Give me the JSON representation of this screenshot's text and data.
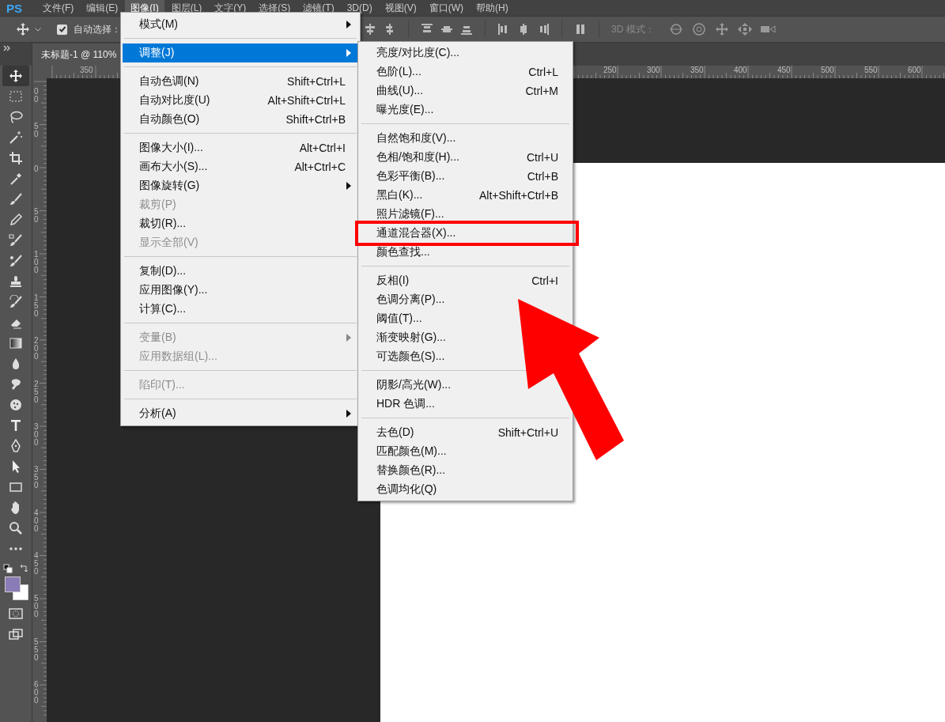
{
  "app_logo": "PS",
  "menubar": {
    "items": [
      {
        "label": "文件(F)",
        "selected": false
      },
      {
        "label": "编辑(E)",
        "selected": false
      },
      {
        "label": "图像(I)",
        "selected": true
      },
      {
        "label": "图层(L)",
        "selected": false
      },
      {
        "label": "文字(Y)",
        "selected": false
      },
      {
        "label": "选择(S)",
        "selected": false
      },
      {
        "label": "滤镜(T)",
        "selected": false
      },
      {
        "label": "3D(D)",
        "selected": false
      },
      {
        "label": "视图(V)",
        "selected": false
      },
      {
        "label": "窗口(W)",
        "selected": false
      },
      {
        "label": "帮助(H)",
        "selected": false
      }
    ]
  },
  "options_bar": {
    "auto_select": {
      "label": "自动选择：",
      "checked": true
    },
    "mode_label": "3D 模式："
  },
  "document_tab": {
    "title": "未标题-1 @ 110%"
  },
  "top_ruler": [
    "350",
    "250",
    "300",
    "350",
    "400",
    "450",
    "500",
    "550",
    "600"
  ],
  "left_ruler": [
    "00",
    "50",
    "0",
    "50",
    "100",
    "150",
    "200",
    "250",
    "300",
    "350",
    "400",
    "450",
    "500",
    "550",
    "600"
  ],
  "toolbar": {
    "tools": [
      {
        "selected": true
      },
      {
        "selected": false
      },
      {
        "selected": false
      },
      {
        "selected": false
      },
      {
        "selected": false
      },
      {
        "selected": false
      },
      {
        "selected": false
      },
      {
        "selected": false
      },
      {
        "selected": false
      },
      {
        "selected": false
      },
      {
        "selected": false
      },
      {
        "selected": false
      },
      {
        "selected": false
      },
      {
        "selected": false
      },
      {
        "selected": false
      },
      {
        "selected": false
      },
      {
        "selected": false
      },
      {
        "selected": false
      },
      {
        "selected": false
      },
      {
        "selected": false
      },
      {
        "selected": false
      },
      {
        "selected": false
      },
      {
        "selected": false
      },
      {
        "selected": false
      }
    ]
  },
  "image_menu": {
    "groups": [
      [
        {
          "label": "模式(M)",
          "submenu": true,
          "disabled": false,
          "selected": false
        }
      ],
      [
        {
          "label": "调整(J)",
          "submenu": true,
          "disabled": false,
          "selected": true
        }
      ],
      [
        {
          "label": "自动色调(N)",
          "shortcut": "Shift+Ctrl+L",
          "submenu": false,
          "disabled": false,
          "selected": false
        },
        {
          "label": "自动对比度(U)",
          "shortcut": "Alt+Shift+Ctrl+L",
          "submenu": false,
          "disabled": false,
          "selected": false
        },
        {
          "label": "自动颜色(O)",
          "shortcut": "Shift+Ctrl+B",
          "submenu": false,
          "disabled": false,
          "selected": false
        }
      ],
      [
        {
          "label": "图像大小(I)...",
          "shortcut": "Alt+Ctrl+I",
          "submenu": false,
          "disabled": false,
          "selected": false
        },
        {
          "label": "画布大小(S)...",
          "shortcut": "Alt+Ctrl+C",
          "submenu": false,
          "disabled": false,
          "selected": false
        },
        {
          "label": "图像旋转(G)",
          "submenu": true,
          "disabled": false,
          "selected": false
        },
        {
          "label": "裁剪(P)",
          "submenu": false,
          "disabled": true,
          "selected": false
        },
        {
          "label": "裁切(R)...",
          "submenu": false,
          "disabled": false,
          "selected": false
        },
        {
          "label": "显示全部(V)",
          "submenu": false,
          "disabled": true,
          "selected": false
        }
      ],
      [
        {
          "label": "复制(D)...",
          "submenu": false,
          "disabled": false,
          "selected": false
        },
        {
          "label": "应用图像(Y)...",
          "submenu": false,
          "disabled": false,
          "selected": false
        },
        {
          "label": "计算(C)...",
          "submenu": false,
          "disabled": false,
          "selected": false
        }
      ],
      [
        {
          "label": "变量(B)",
          "submenu": true,
          "disabled": true,
          "selected": false
        },
        {
          "label": "应用数据组(L)...",
          "submenu": false,
          "disabled": true,
          "selected": false
        }
      ],
      [
        {
          "label": "陷印(T)...",
          "submenu": false,
          "disabled": true,
          "selected": false
        }
      ],
      [
        {
          "label": "分析(A)",
          "submenu": true,
          "disabled": false,
          "selected": false
        }
      ]
    ]
  },
  "adjust_submenu": {
    "groups": [
      [
        {
          "label": "亮度/对比度(C)..."
        },
        {
          "label": "色阶(L)...",
          "shortcut": "Ctrl+L"
        },
        {
          "label": "曲线(U)...",
          "shortcut": "Ctrl+M"
        },
        {
          "label": "曝光度(E)..."
        }
      ],
      [
        {
          "label": "自然饱和度(V)..."
        },
        {
          "label": "色相/饱和度(H)...",
          "shortcut": "Ctrl+U"
        },
        {
          "label": "色彩平衡(B)...",
          "shortcut": "Ctrl+B"
        },
        {
          "label": "黑白(K)...",
          "shortcut": "Alt+Shift+Ctrl+B"
        },
        {
          "label": "照片滤镜(F)..."
        },
        {
          "label": "通道混合器(X)..."
        },
        {
          "label": "颜色查找..."
        }
      ],
      [
        {
          "label": "反相(I)",
          "shortcut": "Ctrl+I"
        },
        {
          "label": "色调分离(P)..."
        },
        {
          "label": "阈值(T)..."
        },
        {
          "label": "渐变映射(G)..."
        },
        {
          "label": "可选颜色(S)..."
        }
      ],
      [
        {
          "label": "阴影/高光(W)..."
        },
        {
          "label": "HDR 色调..."
        }
      ],
      [
        {
          "label": "去色(D)",
          "shortcut": "Shift+Ctrl+U"
        },
        {
          "label": "匹配颜色(M)..."
        },
        {
          "label": "替换颜色(R)..."
        },
        {
          "label": "色调均化(Q)"
        }
      ]
    ]
  }
}
